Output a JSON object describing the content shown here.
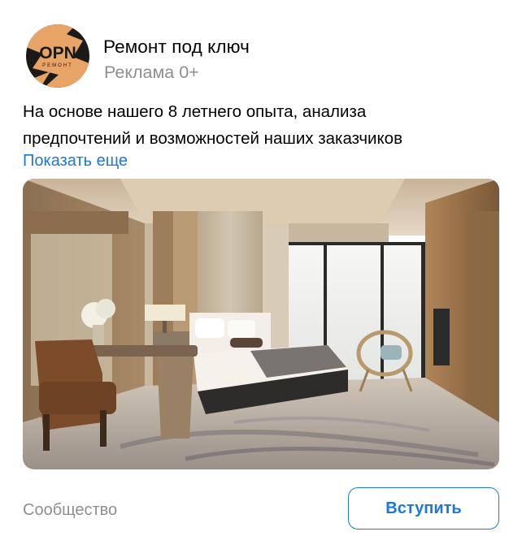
{
  "post": {
    "author": "Ремонт под ключ",
    "subtitle": "Реклама 0+",
    "text_lines": [
      "На основе нашего 8 летнего опыта, анализа",
      "предпочтений и возможностей наших заказчиков"
    ],
    "show_more": "Показать еще",
    "image_icon": "bedroom-interior-photo",
    "category": "Сообщество",
    "join_button": "Вступить"
  },
  "logo": {
    "text": "OPN",
    "subtext": "РЕМОНТ",
    "icon": "opn-logo-icon"
  },
  "colors": {
    "accent": "#1e78d6",
    "secondary_text": "#8e8e93",
    "logo_orange": "#e8a366",
    "logo_dark": "#1c1a18"
  }
}
